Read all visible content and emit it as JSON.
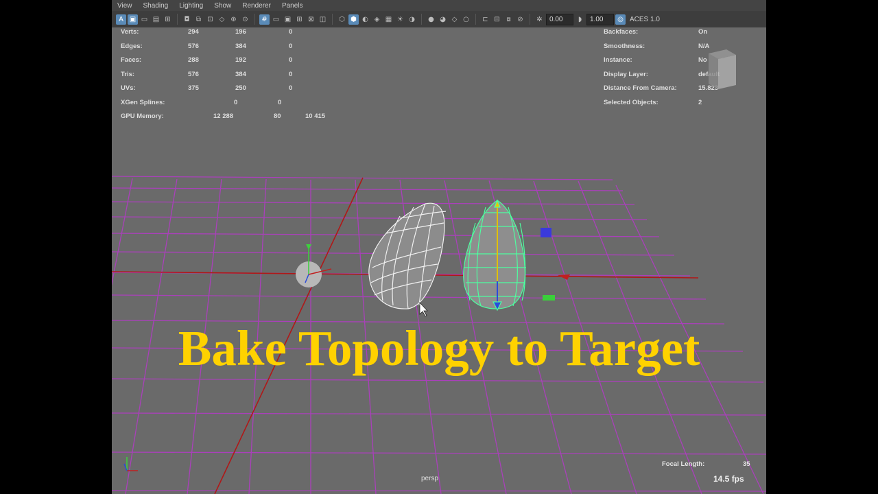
{
  "menu": [
    "View",
    "Shading",
    "Lighting",
    "Show",
    "Renderer",
    "Panels"
  ],
  "toolbar": {
    "exposure_value": "0.00",
    "gamma_value": "1.00",
    "color_space": "ACES 1.0"
  },
  "stats": {
    "rows": [
      {
        "label": "Verts:",
        "v1": "294",
        "v2": "196",
        "v3": "0"
      },
      {
        "label": "Edges:",
        "v1": "576",
        "v2": "384",
        "v3": "0"
      },
      {
        "label": "Faces:",
        "v1": "288",
        "v2": "192",
        "v3": "0"
      },
      {
        "label": "Tris:",
        "v1": "576",
        "v2": "384",
        "v3": "0"
      },
      {
        "label": "UVs:",
        "v1": "375",
        "v2": "250",
        "v3": "0"
      },
      {
        "label": "XGen Splines:",
        "v1": "0",
        "v2": "0",
        "v3": ""
      },
      {
        "label": "GPU Memory:",
        "v1": "12 288",
        "v2": "80",
        "v3": "10 415"
      }
    ]
  },
  "object_info": {
    "rows": [
      {
        "label": "Backfaces:",
        "value": "On"
      },
      {
        "label": "Smoothness:",
        "value": "N/A"
      },
      {
        "label": "Instance:",
        "value": "No"
      },
      {
        "label": "Display Layer:",
        "value": "default"
      },
      {
        "label": "Distance From Camera:",
        "value": "15.823"
      },
      {
        "label": "Selected Objects:",
        "value": "2"
      }
    ]
  },
  "viewport": {
    "camera": "persp",
    "focal_label": "Focal Length:",
    "focal_value": "35",
    "fps": "14.5 fps"
  },
  "overlay_title": "Bake Topology to Target",
  "colors": {
    "grid": "#b23cc4",
    "axis_red": "#b01818",
    "selection_green": "#4dffa0",
    "title_yellow": "#ffd200"
  }
}
